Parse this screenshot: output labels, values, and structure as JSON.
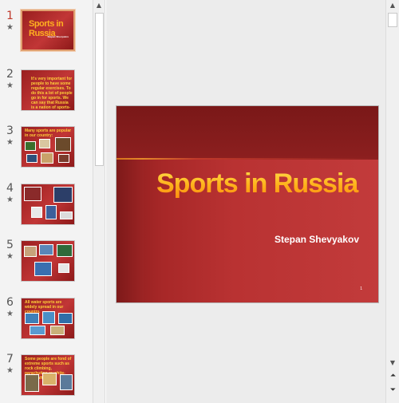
{
  "slides": [
    {
      "number": "1",
      "star": "★",
      "title": "Sports in Russia",
      "subtitle": "Stepan Shevyakov"
    },
    {
      "number": "2",
      "star": "★",
      "title": "It's very important for people to have some regular exercises. To do this a lot of people go in for sports. We can say that Russia is a nation of sports-lovers."
    },
    {
      "number": "3",
      "star": "★",
      "title": "Many sports are popular in our country:"
    },
    {
      "number": "4",
      "star": "★",
      "title": ""
    },
    {
      "number": "5",
      "star": "★",
      "title": ""
    },
    {
      "number": "6",
      "star": "★",
      "title": "All water sports are widely spread in our country."
    },
    {
      "number": "7",
      "star": "★",
      "title": "Some people are fond of extreme sports such as rock climbing, parachuting or white-water rafting."
    }
  ],
  "main_slide": {
    "title": "Sports in Russia",
    "subtitle": "Stepan Shevyakov",
    "page_marker": "1"
  },
  "scrollbars": {
    "up": "▲",
    "down": "▼",
    "prev_slide": "⏶",
    "next_slide": "⏷"
  },
  "colors": {
    "slide_red": "#b93232",
    "title_gold": "#ffb21f",
    "accent_orange": "#e48a2a"
  }
}
